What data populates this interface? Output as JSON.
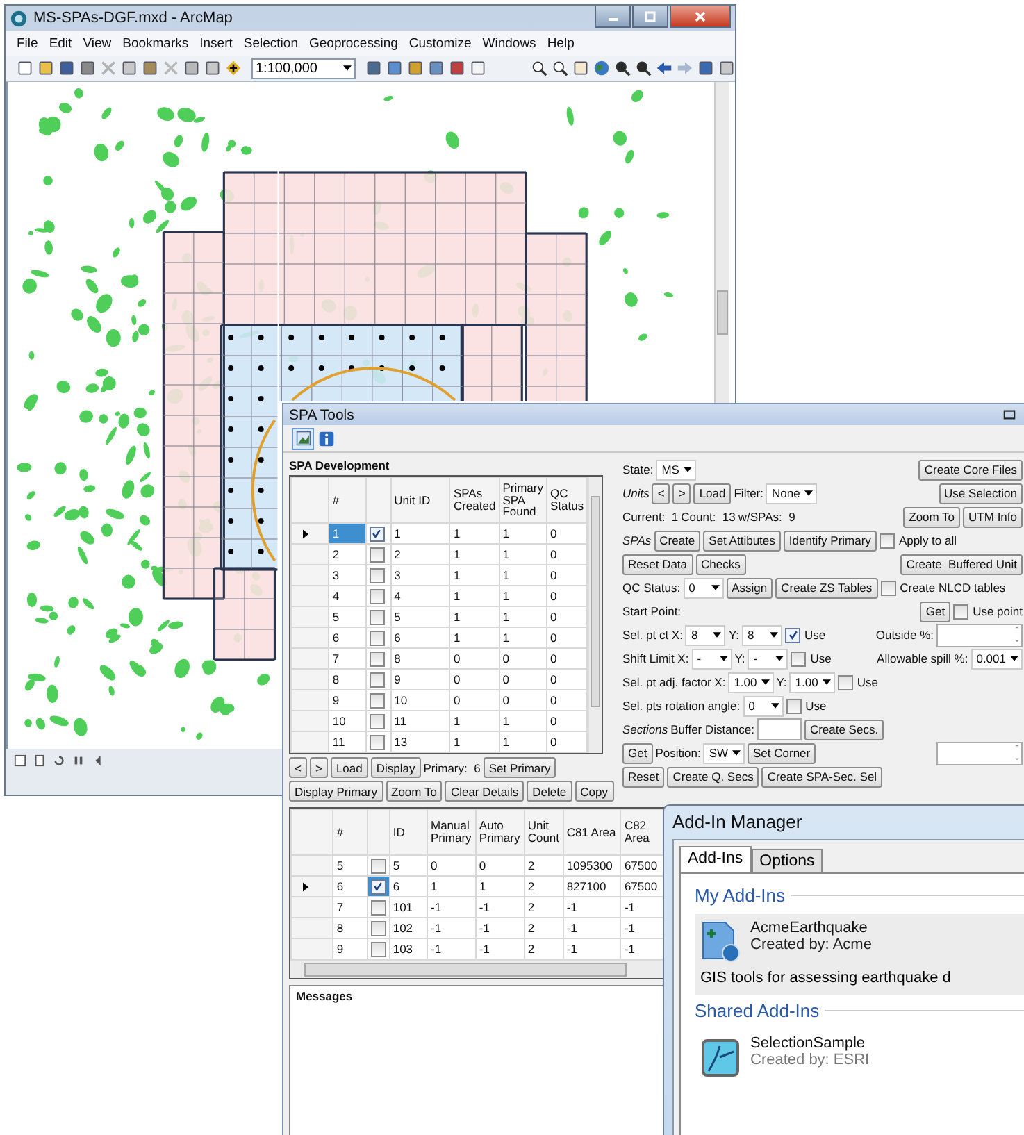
{
  "arcmap": {
    "title": "MS-SPAs-DGF.mxd - ArcMap",
    "menu": [
      "File",
      "Edit",
      "View",
      "Bookmarks",
      "Insert",
      "Selection",
      "Geoprocessing",
      "Customize",
      "Windows",
      "Help"
    ],
    "scale": "1:100,000"
  },
  "spa_tools": {
    "title": "SPA Tools",
    "section": "SPA Development",
    "units_table": {
      "columns": [
        "#",
        "Unit ID",
        "SPAs Created",
        "Primary SPA Found",
        "QC Status"
      ],
      "rows": [
        {
          "cells": [
            "1",
            "1",
            "1",
            "1",
            "0"
          ],
          "checked": true,
          "selected": true
        },
        {
          "cells": [
            "2",
            "2",
            "1",
            "1",
            "0"
          ],
          "checked": false,
          "selected": false
        },
        {
          "cells": [
            "3",
            "3",
            "1",
            "1",
            "0"
          ],
          "checked": false,
          "selected": false
        },
        {
          "cells": [
            "4",
            "4",
            "1",
            "1",
            "0"
          ],
          "checked": false,
          "selected": false
        },
        {
          "cells": [
            "5",
            "5",
            "1",
            "1",
            "0"
          ],
          "checked": false,
          "selected": false
        },
        {
          "cells": [
            "6",
            "6",
            "1",
            "1",
            "0"
          ],
          "checked": false,
          "selected": false
        },
        {
          "cells": [
            "7",
            "8",
            "0",
            "0",
            "0"
          ],
          "checked": false,
          "selected": false
        },
        {
          "cells": [
            "8",
            "9",
            "0",
            "0",
            "0"
          ],
          "checked": false,
          "selected": false
        },
        {
          "cells": [
            "9",
            "10",
            "0",
            "0",
            "0"
          ],
          "checked": false,
          "selected": false
        },
        {
          "cells": [
            "10",
            "11",
            "1",
            "1",
            "0"
          ],
          "checked": false,
          "selected": false
        },
        {
          "cells": [
            "11",
            "13",
            "1",
            "1",
            "0"
          ],
          "checked": false,
          "selected": false
        }
      ]
    },
    "units_toolbar": [
      {
        "kind": "button",
        "text": "<"
      },
      {
        "kind": "button",
        "text": ">"
      },
      {
        "kind": "button",
        "text": "Load"
      },
      {
        "kind": "button",
        "text": "Display"
      },
      {
        "kind": "label",
        "text": "Primary:  6"
      },
      {
        "kind": "button",
        "text": "Set Primary"
      }
    ],
    "details_toolbar": [
      {
        "kind": "button",
        "text": "Display Primary"
      },
      {
        "kind": "button",
        "text": "Zoom To"
      },
      {
        "kind": "button",
        "text": "Clear Details"
      },
      {
        "kind": "button",
        "text": "Delete"
      },
      {
        "kind": "button",
        "text": "Copy"
      }
    ],
    "details_table": {
      "columns": [
        "#",
        "ID",
        "Manual Primary",
        "Auto Primary",
        "Unit Count",
        "C81 Area",
        "C82 Area"
      ],
      "rows": [
        {
          "cells": [
            "5",
            "5",
            "0",
            "0",
            "2",
            "1095300",
            "67500"
          ],
          "checked": false,
          "selected": false
        },
        {
          "cells": [
            "6",
            "6",
            "1",
            "1",
            "2",
            "827100",
            "67500"
          ],
          "checked": true,
          "selected": true
        },
        {
          "cells": [
            "7",
            "101",
            "-1",
            "-1",
            "2",
            "-1",
            "-1"
          ],
          "checked": false,
          "selected": false
        },
        {
          "cells": [
            "8",
            "102",
            "-1",
            "-1",
            "2",
            "-1",
            "-1"
          ],
          "checked": false,
          "selected": false
        },
        {
          "cells": [
            "9",
            "103",
            "-1",
            "-1",
            "2",
            "-1",
            "-1"
          ],
          "checked": false,
          "selected": false
        }
      ]
    },
    "messages": {
      "title": "Messages"
    },
    "controls": [
      {
        "left": [
          {
            "kind": "label",
            "text": "State:"
          },
          {
            "kind": "dropdown",
            "value": "MS"
          }
        ],
        "right": [
          {
            "kind": "button",
            "text": "Create Core Files"
          }
        ]
      },
      {
        "left": [
          {
            "kind": "caption",
            "text": "Units"
          },
          {
            "kind": "button",
            "text": "<"
          },
          {
            "kind": "button",
            "text": ">"
          },
          {
            "kind": "button",
            "text": "Load"
          },
          {
            "kind": "label",
            "text": "Filter:"
          },
          {
            "kind": "dropdown",
            "value": "None"
          }
        ],
        "right": [
          {
            "kind": "button",
            "text": "Use Selection"
          }
        ]
      },
      {
        "left": [
          {
            "kind": "label",
            "text": "Current:  1"
          },
          {
            "kind": "label",
            "text": "Count:  13"
          },
          {
            "kind": "label",
            "text": "w/SPAs:  9"
          }
        ],
        "right": [
          {
            "kind": "button",
            "text": "Zoom To"
          },
          {
            "kind": "button",
            "text": "UTM Info"
          }
        ]
      },
      {
        "left": [
          {
            "kind": "caption",
            "text": "SPAs"
          },
          {
            "kind": "button",
            "text": "Create"
          },
          {
            "kind": "button",
            "text": "Set Attibutes"
          },
          {
            "kind": "button",
            "text": "Identify Primary"
          },
          {
            "kind": "checkbox",
            "text": "Apply to all",
            "checked": false
          }
        ]
      },
      {
        "left": [
          {
            "kind": "button",
            "text": "Reset Data"
          },
          {
            "kind": "button",
            "text": "Checks"
          }
        ],
        "right": [
          {
            "kind": "button",
            "text": "Create  Buffered Unit"
          }
        ]
      },
      {
        "left": [
          {
            "kind": "label",
            "text": "QC Status:"
          },
          {
            "kind": "dropdown",
            "value": "0"
          },
          {
            "kind": "button",
            "text": "Assign"
          },
          {
            "kind": "button",
            "text": "Create ZS Tables"
          },
          {
            "kind": "checkbox",
            "text": "Create NLCD tables",
            "checked": false
          }
        ]
      },
      {
        "left": [
          {
            "kind": "label",
            "text": "Start Point:"
          }
        ],
        "right": [
          {
            "kind": "button",
            "text": "Get"
          },
          {
            "kind": "checkbox",
            "text": "Use point",
            "checked": false
          }
        ]
      },
      {
        "left": [
          {
            "kind": "label",
            "text": "Sel. pt ct X:"
          },
          {
            "kind": "dropdown",
            "value": "8"
          },
          {
            "kind": "label",
            "text": "Y:"
          },
          {
            "kind": "dropdown",
            "value": "8"
          },
          {
            "kind": "checkbox",
            "text": "Use",
            "checked": true
          }
        ],
        "right": [
          {
            "kind": "label",
            "text": "Outside %:"
          },
          {
            "kind": "listbox"
          }
        ]
      },
      {
        "left": [
          {
            "kind": "label",
            "text": "Shift Limit X:"
          },
          {
            "kind": "dropdown",
            "value": "-"
          },
          {
            "kind": "label",
            "text": "Y:"
          },
          {
            "kind": "dropdown",
            "value": "-"
          },
          {
            "kind": "checkbox",
            "text": "Use",
            "checked": false
          }
        ],
        "right": [
          {
            "kind": "label",
            "text": "Allowable spill %:"
          },
          {
            "kind": "dropdown",
            "value": "0.001"
          }
        ]
      },
      {
        "left": [
          {
            "kind": "label",
            "text": "Sel. pt adj. factor X:"
          },
          {
            "kind": "dropdown",
            "value": "1.00"
          },
          {
            "kind": "label",
            "text": "Y:"
          },
          {
            "kind": "dropdown",
            "value": "1.00"
          },
          {
            "kind": "checkbox",
            "text": "Use",
            "checked": false
          }
        ]
      },
      {
        "left": [
          {
            "kind": "label",
            "text": "Sel. pts rotation angle:"
          },
          {
            "kind": "dropdown",
            "value": "0"
          },
          {
            "kind": "checkbox",
            "text": "Use",
            "checked": false
          }
        ]
      },
      {
        "left": [
          {
            "kind": "caption",
            "text": "Sections"
          },
          {
            "kind": "label",
            "text": "Buffer Distance:"
          },
          {
            "kind": "textbox"
          },
          {
            "kind": "button",
            "text": "Create Secs."
          }
        ]
      },
      {
        "left": [
          {
            "kind": "button",
            "text": "Get"
          },
          {
            "kind": "label",
            "text": "Position:"
          },
          {
            "kind": "dropdown",
            "value": "SW"
          },
          {
            "kind": "button",
            "text": "Set Corner"
          }
        ],
        "right": [
          {
            "kind": "listbox"
          }
        ]
      },
      {
        "left": [
          {
            "kind": "button",
            "text": "Reset"
          },
          {
            "kind": "button",
            "text": "Create Q. Secs"
          },
          {
            "kind": "button",
            "text": "Create SPA-Sec. Sel"
          }
        ]
      }
    ]
  },
  "addin_manager": {
    "title": "Add-In Manager",
    "tabs": [
      {
        "label": "Add-Ins",
        "selected": true
      },
      {
        "label": "Options",
        "selected": false
      }
    ],
    "groups": [
      {
        "title": "My Add-Ins",
        "items": [
          {
            "name": "AcmeEarthquake",
            "author": "Created by: Acme",
            "description": "GIS tools for assessing earthquake d",
            "selected": true
          }
        ]
      },
      {
        "title": "Shared Add-Ins",
        "items": [
          {
            "name": "SelectionSample",
            "author": "Created by: ESRI",
            "selected": false
          }
        ]
      }
    ]
  }
}
